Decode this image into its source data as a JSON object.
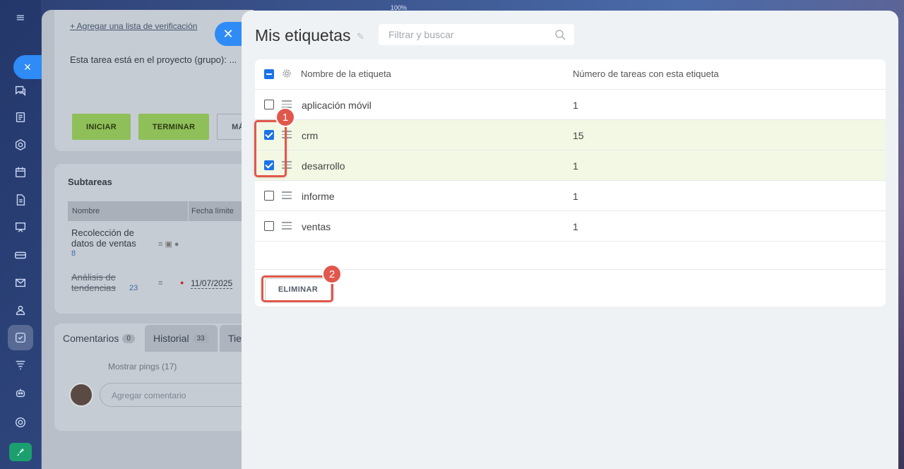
{
  "app": {
    "zoom": "100%"
  },
  "background_task": {
    "add_checklist": "+ Agregar una lista de verificación",
    "project_text": "Esta tarea está en el proyecto (grupo): ...",
    "buttons": {
      "start": "INICIAR",
      "finish": "TERMINAR",
      "more": "MÁ"
    },
    "subtasks": {
      "title": "Subtareas",
      "col_name": "Nombre",
      "col_deadline": "Fecha límite",
      "rows": [
        {
          "name": "Recolección de datos de ventas",
          "count": "8",
          "deadline": ""
        },
        {
          "name": "Análisis de tendencias",
          "count": "23",
          "deadline": "11/07/2025"
        }
      ]
    },
    "tabs": [
      {
        "label": "Comentarios",
        "count": "0"
      },
      {
        "label": "Historial",
        "count": "33"
      },
      {
        "label": "Tie",
        "count": ""
      }
    ],
    "show_pings": "Mostrar pings (17)",
    "comment_placeholder": "Agregar comentario"
  },
  "panel": {
    "title": "Mis etiquetas",
    "search_placeholder": "Filtrar y buscar",
    "columns": {
      "name": "Nombre de la etiqueta",
      "count": "Número de tareas con esta etiqueta"
    },
    "rows": [
      {
        "name": "aplicación móvil",
        "count": "1",
        "checked": false
      },
      {
        "name": "crm",
        "count": "15",
        "checked": true
      },
      {
        "name": "desarrollo",
        "count": "1",
        "checked": true
      },
      {
        "name": "informe",
        "count": "1",
        "checked": false
      },
      {
        "name": "ventas",
        "count": "1",
        "checked": false
      }
    ],
    "delete_label": "ELIMINAR"
  },
  "callouts": {
    "one": "1",
    "two": "2"
  },
  "colors": {
    "accent": "#1b73e8",
    "callout": "#e2574c",
    "selected_row": "#f2f8e4",
    "start_button": "#7cb54a"
  }
}
